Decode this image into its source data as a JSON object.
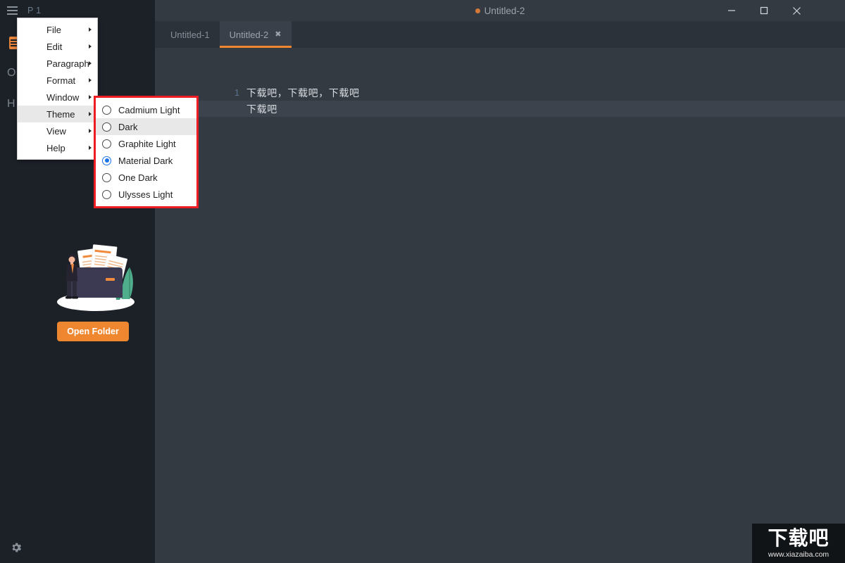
{
  "window": {
    "title": "Untitled-2",
    "unsaved_indicator": true,
    "controls": {
      "minimize": "minimize-button",
      "maximize": "maximize-button",
      "close": "close-button"
    }
  },
  "sidebar": {
    "hamburger_icon": "hamburger-menu-icon",
    "project_label": "P 1",
    "doc_icon": "document-icon",
    "partial_labels": [
      "O",
      "H"
    ],
    "open_folder_label": "Open Folder",
    "settings_icon": "gear-icon",
    "illustration": "open-folder-illustration"
  },
  "tabs": [
    {
      "label": "Untitled-1",
      "active": false,
      "closable": false
    },
    {
      "label": "Untitled-2",
      "active": true,
      "closable": true,
      "close_glyph": "✖"
    }
  ],
  "editor": {
    "lines": [
      {
        "number": "1",
        "text": "下载吧，下载吧，下载吧",
        "active": false
      },
      {
        "number": "",
        "text": "下载吧",
        "active": true
      }
    ]
  },
  "menu": {
    "items": [
      {
        "label": "File",
        "has_submenu": true,
        "active": false
      },
      {
        "label": "Edit",
        "has_submenu": true,
        "active": false
      },
      {
        "label": "Paragraph",
        "has_submenu": true,
        "active": false
      },
      {
        "label": "Format",
        "has_submenu": true,
        "active": false
      },
      {
        "label": "Window",
        "has_submenu": true,
        "active": false
      },
      {
        "label": "Theme",
        "has_submenu": true,
        "active": true
      },
      {
        "label": "View",
        "has_submenu": true,
        "active": false
      },
      {
        "label": "Help",
        "has_submenu": true,
        "active": false
      }
    ]
  },
  "submenu": {
    "parent": "Theme",
    "highlight_border_color": "#ee1c25",
    "items": [
      {
        "label": "Cadmium Light",
        "selected": false,
        "hovered": false
      },
      {
        "label": "Dark",
        "selected": false,
        "hovered": true
      },
      {
        "label": "Graphite Light",
        "selected": false,
        "hovered": false
      },
      {
        "label": "Material Dark",
        "selected": true,
        "hovered": false
      },
      {
        "label": "One Dark",
        "selected": false,
        "hovered": false
      },
      {
        "label": "Ulysses Light",
        "selected": false,
        "hovered": false
      }
    ]
  },
  "watermark": {
    "text_cn": "下载吧",
    "url": "www.xiazaiba.com"
  },
  "colors": {
    "accent": "#ef8730",
    "sidebar_bg": "#1c2128",
    "editor_bg": "#343a42",
    "tabbar_bg": "#2c323a",
    "active_tab_bg": "#3a4049",
    "active_line_bg": "#3c434c",
    "radio_selected": "#1a73e8",
    "menu_bg": "#ffffff",
    "menu_highlight": "#e8e8e8",
    "red_box": "#ee1c25"
  }
}
